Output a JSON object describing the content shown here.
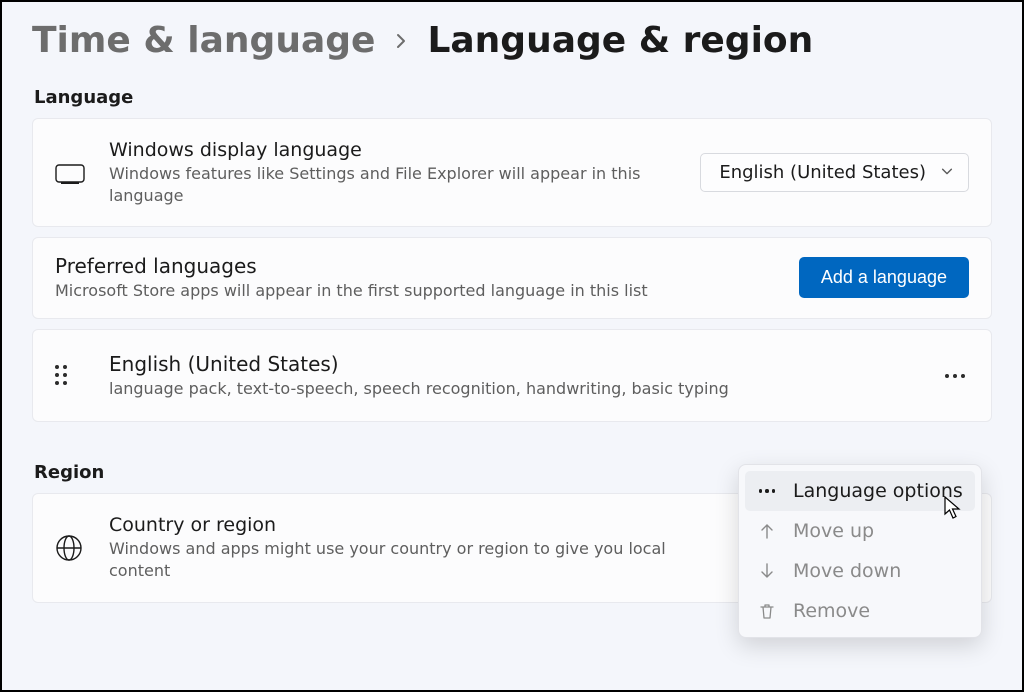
{
  "breadcrumb": {
    "parent": "Time & language",
    "current": "Language & region"
  },
  "sections": {
    "language": {
      "heading": "Language",
      "display_language": {
        "title": "Windows display language",
        "desc": "Windows features like Settings and File Explorer will appear in this language",
        "selected": "English (United States)"
      },
      "preferred": {
        "title": "Preferred languages",
        "desc": "Microsoft Store apps will appear in the first supported language in this list",
        "add_button": "Add a language"
      },
      "items": [
        {
          "name": "English (United States)",
          "features": "language pack, text-to-speech, speech recognition, handwriting, basic typing"
        }
      ]
    },
    "region": {
      "heading": "Region",
      "country": {
        "title": "Country or region",
        "desc": "Windows and apps might use your country or region to give you local content"
      }
    }
  },
  "context_menu": {
    "language_options": "Language options",
    "move_up": "Move up",
    "move_down": "Move down",
    "remove": "Remove"
  }
}
